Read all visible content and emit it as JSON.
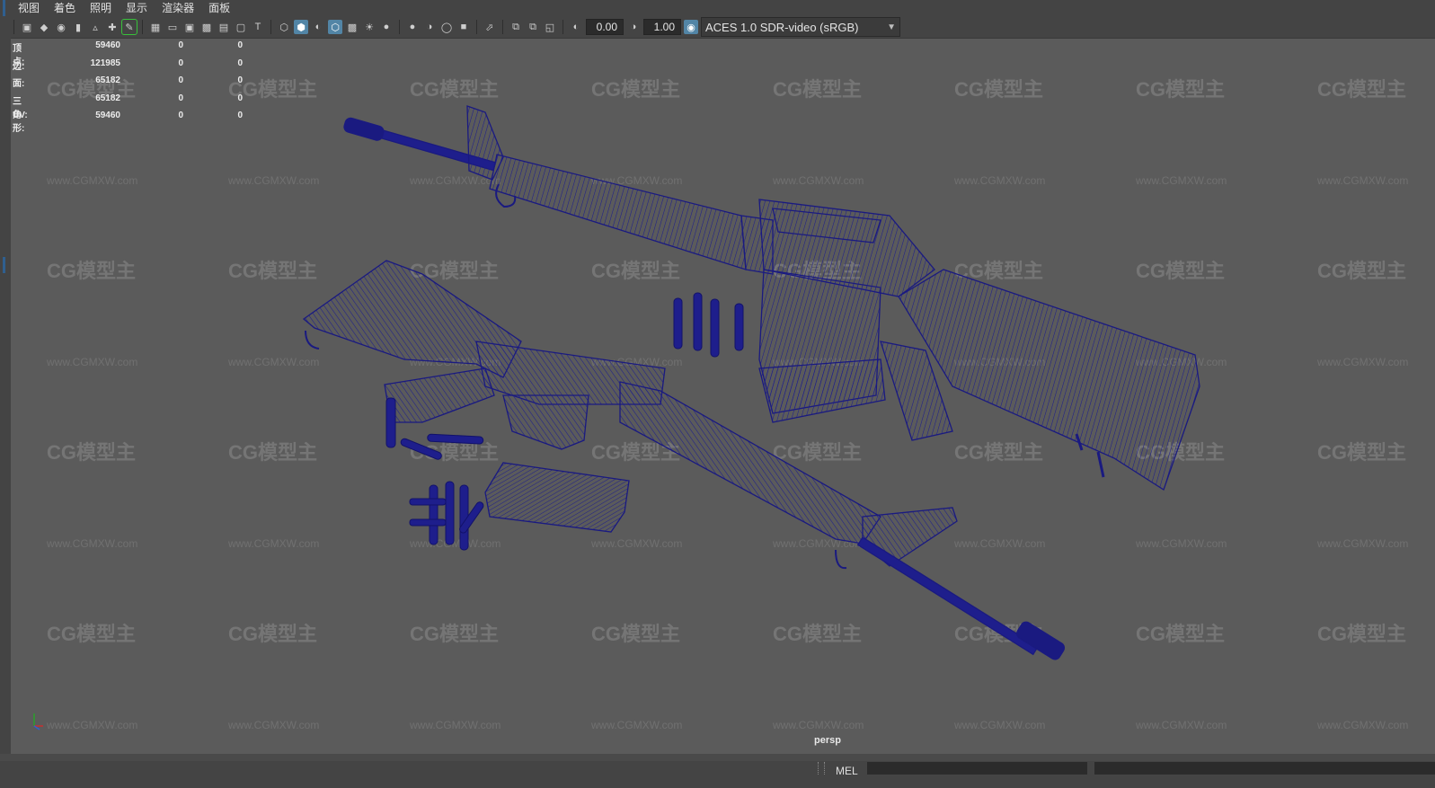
{
  "menu": [
    "视图",
    "着色",
    "照明",
    "显示",
    "渲染器",
    "面板"
  ],
  "toolbar": {
    "icons": [
      "camera-icon",
      "camera-lock-icon",
      "camera-attr-icon",
      "bookmark-icon",
      "image-plane-icon",
      "2d-pan-icon",
      "grease-pencil-icon",
      "grid-icon",
      "film-gate-icon",
      "resolution-gate-icon",
      "gate-mask-icon",
      "field-chart-icon",
      "safe-action-icon",
      "safe-title-icon",
      "wireframe-icon",
      "smooth-shade-icon",
      "default-material-icon",
      "xray-icon",
      "textured-icon",
      "use-lights-icon",
      "shadows-icon",
      "ambient-occlusion-icon",
      "motion-blur-icon",
      "anti-alias-icon",
      "depth-of-field-icon",
      "isolate-select-icon",
      "xray-joints-icon",
      "xray-active-icon",
      "backface-cull-icon",
      "exposure-icon",
      "gamma-icon",
      "color-management-icon"
    ],
    "exposure_value": "0.00",
    "gamma_value": "1.00",
    "color_space": "ACES 1.0 SDR-video (sRGB)"
  },
  "hud": {
    "rows": [
      {
        "label": "顶点:",
        "v1": "59460",
        "v2": "0",
        "v3": "0"
      },
      {
        "label": "边:",
        "v1": "121985",
        "v2": "0",
        "v3": "0"
      },
      {
        "label": "面:",
        "v1": "65182",
        "v2": "0",
        "v3": "0"
      },
      {
        "label": "三角形:",
        "v1": "65182",
        "v2": "0",
        "v3": "0"
      },
      {
        "label": "UV:",
        "v1": "59460",
        "v2": "0",
        "v3": "0"
      }
    ]
  },
  "camera_label": "persp",
  "watermark": {
    "logo": "CG模型主",
    "url": "www.CGMXW.com"
  },
  "command_line": {
    "mode": "MEL"
  },
  "colors": {
    "wire": "#1e1e8c",
    "wire_dark": "#12126a",
    "bg": "#5b5b5b",
    "accent": "#5285a6"
  }
}
